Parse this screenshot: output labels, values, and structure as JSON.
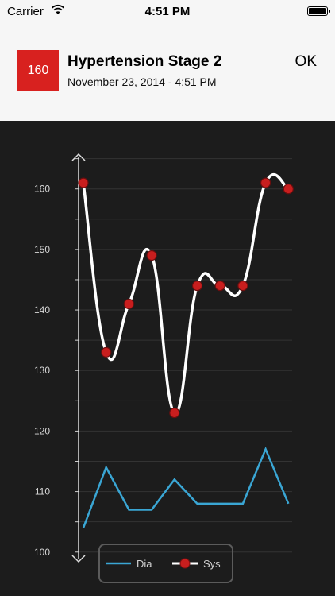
{
  "status_bar": {
    "carrier": "Carrier",
    "time": "4:51 PM"
  },
  "header": {
    "reading_value": "160",
    "title": "Hypertension Stage 2",
    "date": "November 23, 2014 - 4:51 PM",
    "ok_label": "OK",
    "badge_color": "#d8211f"
  },
  "legend": {
    "dia_label": "Dia",
    "sys_label": "Sys"
  },
  "chart_data": {
    "type": "line",
    "ylim": [
      98,
      166
    ],
    "y_ticks": [
      100,
      110,
      120,
      130,
      140,
      150,
      160
    ],
    "grid": true,
    "legend_position": "bottom",
    "series": [
      {
        "name": "Sys",
        "color": "#ffffff",
        "marker_color": "#c81e1e",
        "values": [
          161,
          133,
          141,
          149,
          123,
          144,
          144,
          144,
          161,
          160
        ]
      },
      {
        "name": "Dia",
        "color": "#3aa6d4",
        "values": [
          104,
          114,
          107,
          107,
          112,
          108,
          108,
          108,
          117,
          108
        ]
      }
    ]
  }
}
